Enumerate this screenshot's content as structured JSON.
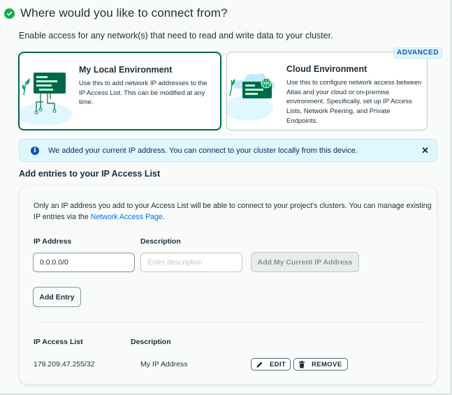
{
  "header": {
    "title": "Where would you like to connect from?"
  },
  "subtitle": "Enable access for any network(s) that need to read and write data to your cluster.",
  "options": {
    "local": {
      "title": "My Local Environment",
      "description": "Use this to add network IP addresses to the IP Access List. This can be modified at any time."
    },
    "cloud": {
      "title": "Cloud Environment",
      "description": "Use this to configure network access between Atlas and your cloud or on-premise environment. Specifically, set up IP Access Lists, Network Peering, and Private Endpoints.",
      "badge": "ADVANCED"
    }
  },
  "banner": {
    "text": "We added your current IP address. You can connect to your cluster locally from this device.",
    "close": "✕"
  },
  "access": {
    "section_title": "Add entries to your IP Access List",
    "description": "Only an IP address you add to your Access List will be able to connect to your project's clusters. You can manage existing IP entries via the ",
    "link": "Network Access Page",
    "description_end": ".",
    "ip_label": "IP Address",
    "ip_value": "0.0.0.0/0",
    "desc_label": "Description",
    "desc_placeholder": "Enter description",
    "add_current_ip": "Add My Current IP Address",
    "add_entry": "Add Entry"
  },
  "list": {
    "col_ip": "IP Access List",
    "col_desc": "Description",
    "rows": [
      {
        "ip": "179.209.47.255/32",
        "description": "My IP Address",
        "edit": "EDIT",
        "remove": "REMOVE"
      }
    ]
  },
  "colors": {
    "accent_green": "#00684a",
    "check_green": "#13aa52",
    "info_blue": "#1254b7",
    "link_blue": "#016bf8"
  }
}
